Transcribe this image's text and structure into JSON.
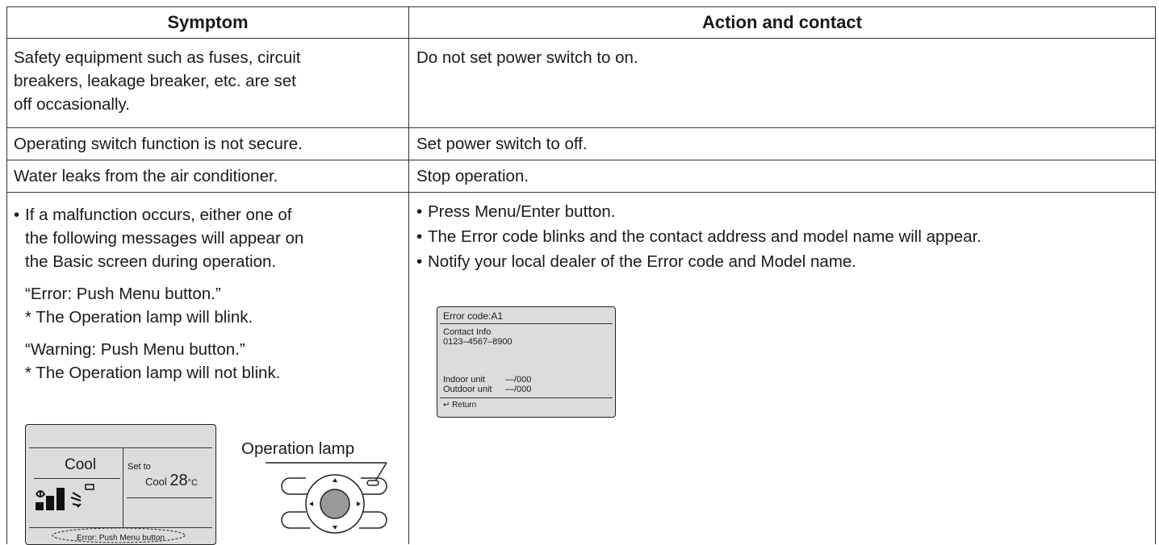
{
  "headers": {
    "symptom": "Symptom",
    "action": "Action and contact"
  },
  "rows": [
    {
      "symptom": [
        "Safety equipment such as fuses, circuit",
        "breakers, leakage breaker, etc. are set",
        "off occasionally."
      ],
      "action": "Do not set power switch to on."
    },
    {
      "symptom": "Operating switch function is not secure.",
      "action": "Set power switch to off."
    },
    {
      "symptom": "Water leaks from the air conditioner.",
      "action": "Stop operation."
    }
  ],
  "malfunction": {
    "symptom_bullet": [
      "If a malfunction occurs, either one of",
      "the following messages will appear on",
      "the Basic screen during operation."
    ],
    "error_msg": "“Error: Push Menu button.”",
    "error_note": "* The Operation lamp will blink.",
    "warning_msg": "“Warning: Push Menu button.”",
    "warning_note": "* The Operation lamp will not blink.",
    "actions": [
      "Press Menu/Enter button.",
      "The Error code blinks and the contact address and model name will appear.",
      "Notify your local dealer of the Error code and Model name."
    ]
  },
  "remote_lcd": {
    "mode": "Cool",
    "set_to": "Set to",
    "set_mode": "Cool",
    "temp": "28",
    "unit": "°C",
    "banner": "Error: Push Menu button"
  },
  "remote_label": "Operation lamp",
  "error_screen": {
    "title": "Error code:A1",
    "contact_label": "Contact Info",
    "phone": "0123–4567–8900",
    "indoor_label": "Indoor unit",
    "indoor_value": "—/000",
    "outdoor_label": "Outdoor unit",
    "outdoor_value": "—/000",
    "return_label": "Return"
  }
}
